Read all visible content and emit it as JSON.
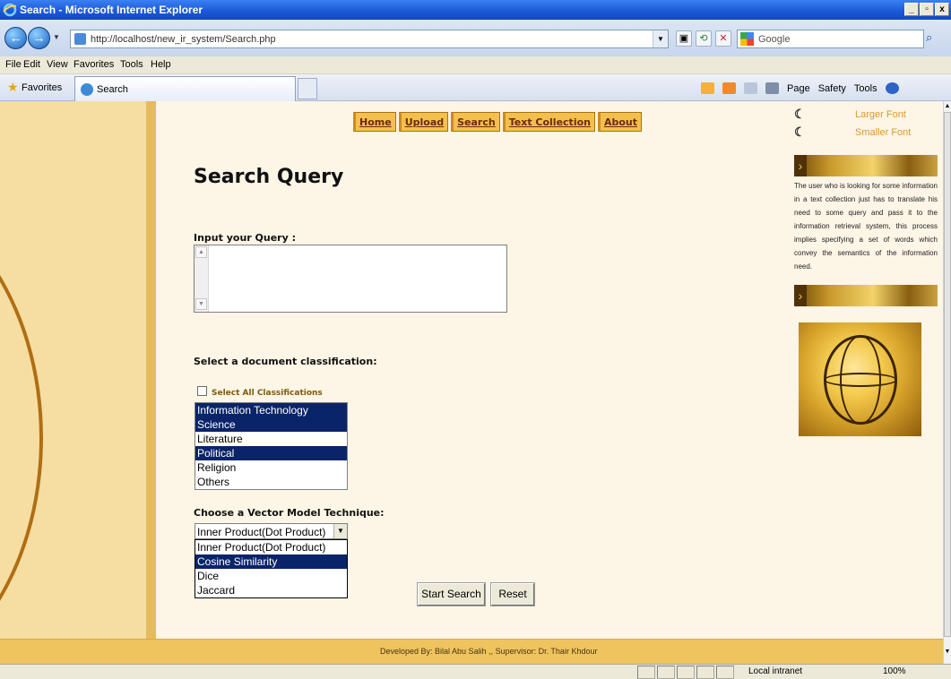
{
  "window": {
    "title": "Search - Microsoft Internet Explorer",
    "controls": [
      "_",
      "̲̅",
      "x"
    ]
  },
  "address": {
    "url": "http://localhost/new_ir_system/Search.php",
    "search_placeholder": "Google"
  },
  "menu": [
    "File",
    "Edit",
    "View",
    "Favorites",
    "Tools",
    "Help"
  ],
  "favorites": {
    "label": "Favorites",
    "tab_title": "Search"
  },
  "command_bar": [
    "Page",
    "Safety",
    "Tools"
  ],
  "page": {
    "nav": [
      "Home",
      "Upload",
      "Search",
      "Text Collection",
      "About"
    ],
    "heading": "Search Query",
    "query_label": "Input your Query :",
    "query_value": "",
    "classification_label": "Select a document classification:",
    "select_all_label": "Select All Classifications",
    "select_all_checked": false,
    "classifications": [
      {
        "label": "Information Technology",
        "selected": true
      },
      {
        "label": "Science",
        "selected": true
      },
      {
        "label": "Literature",
        "selected": false
      },
      {
        "label": "Political",
        "selected": true
      },
      {
        "label": "Religion",
        "selected": false
      },
      {
        "label": "Others",
        "selected": false
      }
    ],
    "vector_label": "Choose a Vector Model Technique:",
    "vector_selected": "Inner Product(Dot Product)",
    "vector_options": [
      {
        "label": "Inner Product(Dot Product)",
        "highlighted": false
      },
      {
        "label": "Cosine Similarity",
        "highlighted": true
      },
      {
        "label": "Dice",
        "highlighted": false
      },
      {
        "label": "Jaccard",
        "highlighted": false
      }
    ],
    "start_button": "Start Search",
    "reset_button": "Reset",
    "larger_font": "Larger Font",
    "smaller_font": "Smaller Font",
    "description": "The user who is looking for some information in a text collection just has to translate his need to some query and pass it to the information retrieval system, this process implies specifying a set of words which convey the semantics of the information need.",
    "footer": "Developed By: Bilal Abu Salih ,, Supervisor: Dr. Thair Khdour"
  },
  "status": {
    "zone": "Local intranet",
    "zoom": "100%"
  }
}
